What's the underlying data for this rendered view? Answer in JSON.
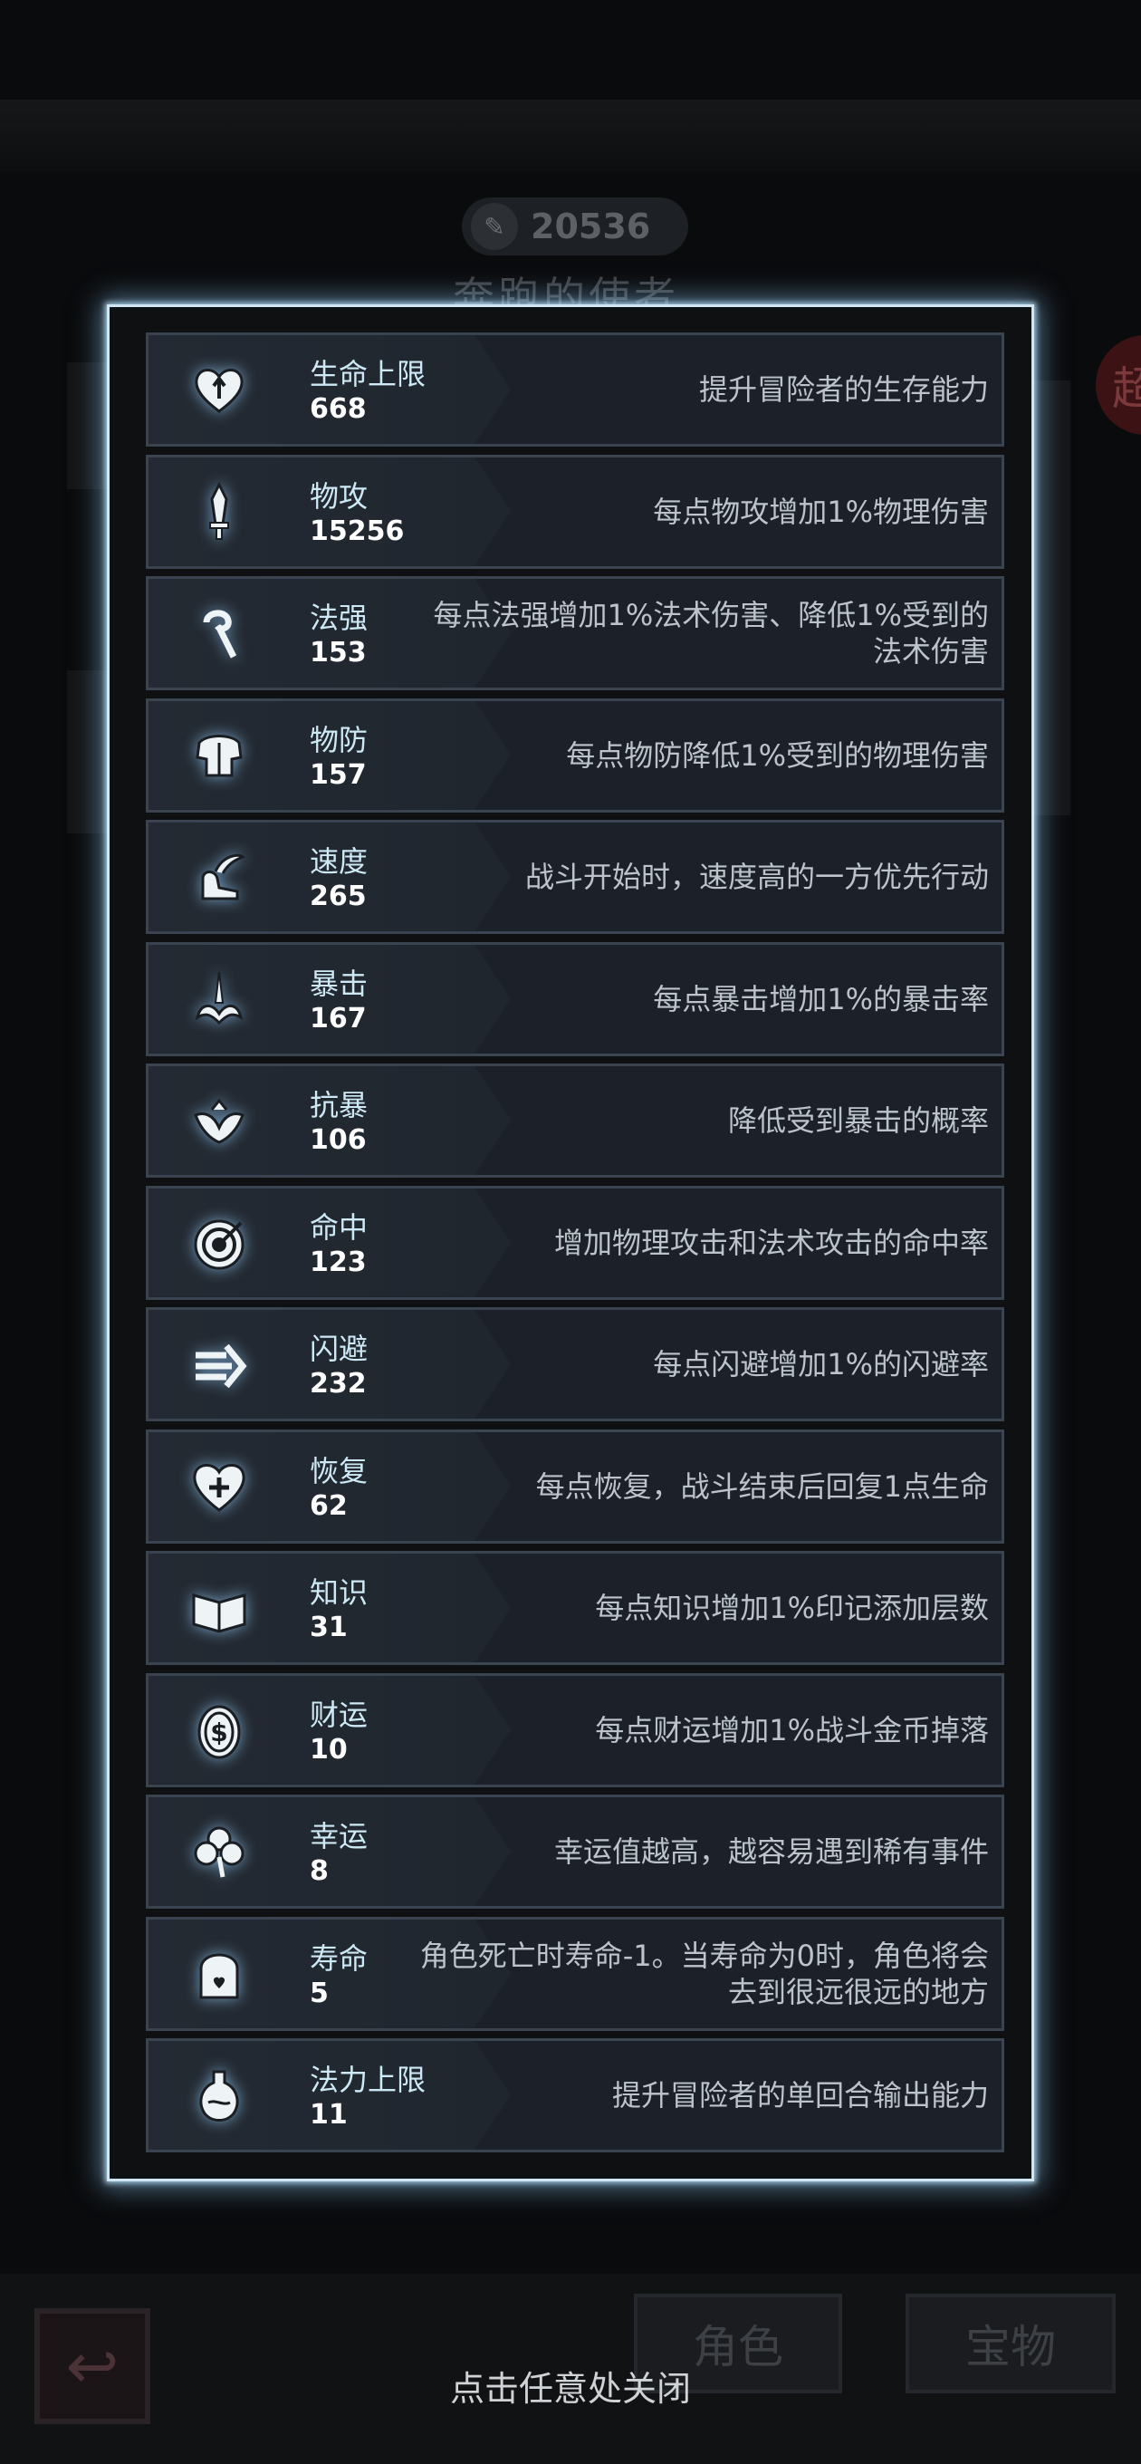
{
  "background": {
    "power_value": "20536",
    "character_name": "奔跑的使者",
    "side_badge": "超",
    "tabs": [
      "角色",
      "宝物"
    ]
  },
  "close_hint": "点击任意处关闭",
  "stats": [
    {
      "name": "生命上限",
      "value": "668",
      "desc": "提升冒险者的生存能力",
      "icon": "heart-arrow-icon"
    },
    {
      "name": "物攻",
      "value": "15256",
      "desc": "每点物攻增加1%物理伤害",
      "icon": "sword-icon"
    },
    {
      "name": "法强",
      "value": "153",
      "desc": "每点法强增加1%法术伤害、降低1%受到的法术伤害",
      "icon": "staff-icon"
    },
    {
      "name": "物防",
      "value": "157",
      "desc": "每点物防降低1%受到的物理伤害",
      "icon": "armor-icon"
    },
    {
      "name": "速度",
      "value": "265",
      "desc": "战斗开始时，速度高的一方优先行动",
      "icon": "winged-boot-icon"
    },
    {
      "name": "暴击",
      "value": "167",
      "desc": "每点暴击增加1%的暴击率",
      "icon": "crit-sword-icon"
    },
    {
      "name": "抗暴",
      "value": "106",
      "desc": "降低受到暴击的概率",
      "icon": "crit-resist-icon"
    },
    {
      "name": "命中",
      "value": "123",
      "desc": "增加物理攻击和法术攻击的命中率",
      "icon": "target-icon"
    },
    {
      "name": "闪避",
      "value": "232",
      "desc": "每点闪避增加1%的闪避率",
      "icon": "dodge-arrow-icon"
    },
    {
      "name": "恢复",
      "value": "62",
      "desc": "每点恢复，战斗结束后回复1点生命",
      "icon": "heart-plus-icon"
    },
    {
      "name": "知识",
      "value": "31",
      "desc": "每点知识增加1%印记添加层数",
      "icon": "book-icon"
    },
    {
      "name": "财运",
      "value": "10",
      "desc": "每点财运增加1%战斗金币掉落",
      "icon": "coin-icon"
    },
    {
      "name": "幸运",
      "value": "8",
      "desc": "幸运值越高，越容易遇到稀有事件",
      "icon": "clover-icon"
    },
    {
      "name": "寿命",
      "value": "5",
      "desc": "角色死亡时寿命-1。当寿命为0时，角色将会去到很远很远的地方",
      "icon": "tombstone-icon"
    },
    {
      "name": "法力上限",
      "value": "11",
      "desc": "提升冒险者的单回合输出能力",
      "icon": "mana-flask-icon"
    }
  ]
}
